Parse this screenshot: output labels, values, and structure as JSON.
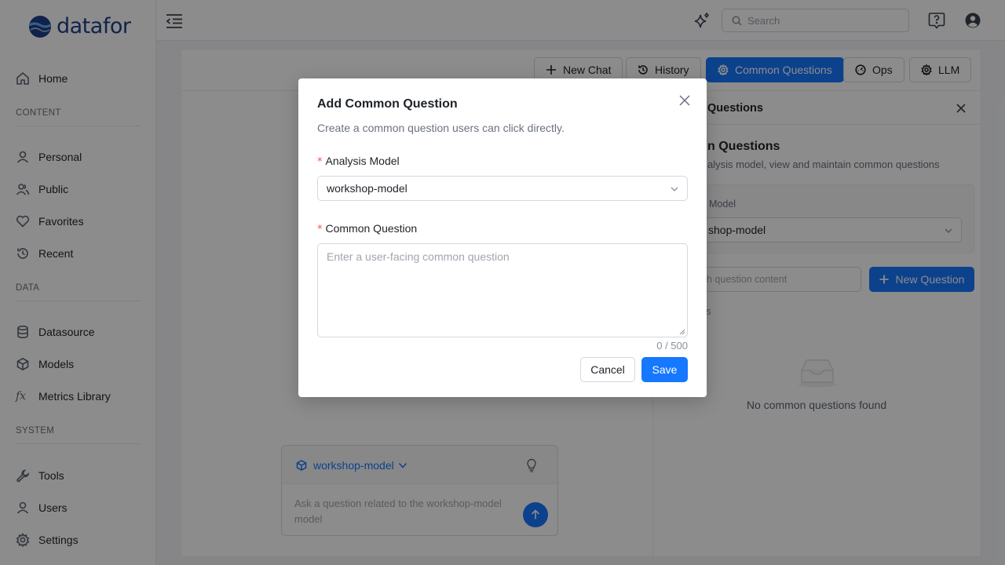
{
  "app": {
    "logo_text": "datafor"
  },
  "sidebar": {
    "items": [
      {
        "label": "Home",
        "icon": "home-icon"
      },
      {
        "label": "Personal",
        "icon": "person-icon"
      },
      {
        "label": "Public",
        "icon": "people-icon"
      },
      {
        "label": "Favorites",
        "icon": "heart-icon"
      },
      {
        "label": "Recent",
        "icon": "history-icon"
      },
      {
        "label": "Datasource",
        "icon": "database-icon"
      },
      {
        "label": "Models",
        "icon": "cube-icon"
      },
      {
        "label": "Metrics Library",
        "icon": "fx-icon"
      },
      {
        "label": "Tools",
        "icon": "wrench-icon"
      },
      {
        "label": "Users",
        "icon": "user-icon"
      },
      {
        "label": "Settings",
        "icon": "gear-icon"
      }
    ],
    "sections": {
      "content": "CONTENT",
      "data": "DATA",
      "system": "SYSTEM"
    },
    "fx_glyph": "fx"
  },
  "topbar": {
    "search_placeholder": "Search"
  },
  "toolbar": {
    "new_chat": "New Chat",
    "history": "History",
    "common_questions": "Common Questions",
    "ops": "Ops",
    "llm": "LLM"
  },
  "panel": {
    "title": "Questions",
    "heading": "n Questions",
    "subtitle": "alysis model, view and maintain common questions",
    "model_label": "Model",
    "model_value": "shop-model",
    "search_placeholder": "h question content",
    "new_question": "New Question",
    "faint_text": "s",
    "empty_text": "No common questions found"
  },
  "chat": {
    "model": "workshop-model",
    "placeholder": "Ask a question related to the workshop-model model"
  },
  "modal": {
    "title": "Add Common Question",
    "description": "Create a common question users can click directly.",
    "required_mark": "*",
    "model_label": "Analysis Model",
    "model_value": "workshop-model",
    "question_label": "Common Question",
    "question_placeholder": "Enter a user-facing common question",
    "counter": "0 / 500",
    "cancel": "Cancel",
    "save": "Save"
  },
  "colors": {
    "primary": "#1677ff",
    "brand": "#1f3f8a",
    "required": "#ff4d4f"
  }
}
